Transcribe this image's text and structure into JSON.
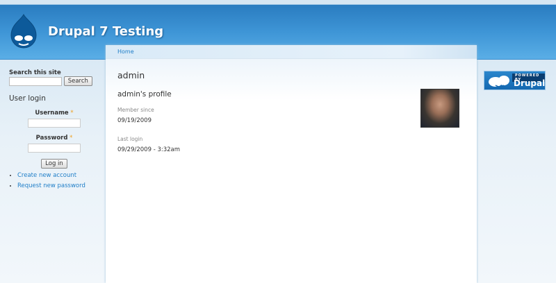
{
  "site": {
    "name": "Drupal 7 Testing"
  },
  "breadcrumb": [
    "Home"
  ],
  "page": {
    "title": "admin",
    "profile_heading": "admin's profile",
    "member_since_label": "Member since",
    "member_since": "09/19/2009",
    "last_login_label": "Last login",
    "last_login": "09/29/2009 - 3:32am"
  },
  "search": {
    "title": "Search this site",
    "button": "Search",
    "value": ""
  },
  "login": {
    "title": "User login",
    "username_label": "Username",
    "password_label": "Password",
    "required": "*",
    "button": "Log in",
    "links": [
      "Create new account",
      "Request new password"
    ]
  },
  "badge": {
    "powered": "POWERED BY",
    "name": "Drupal"
  }
}
